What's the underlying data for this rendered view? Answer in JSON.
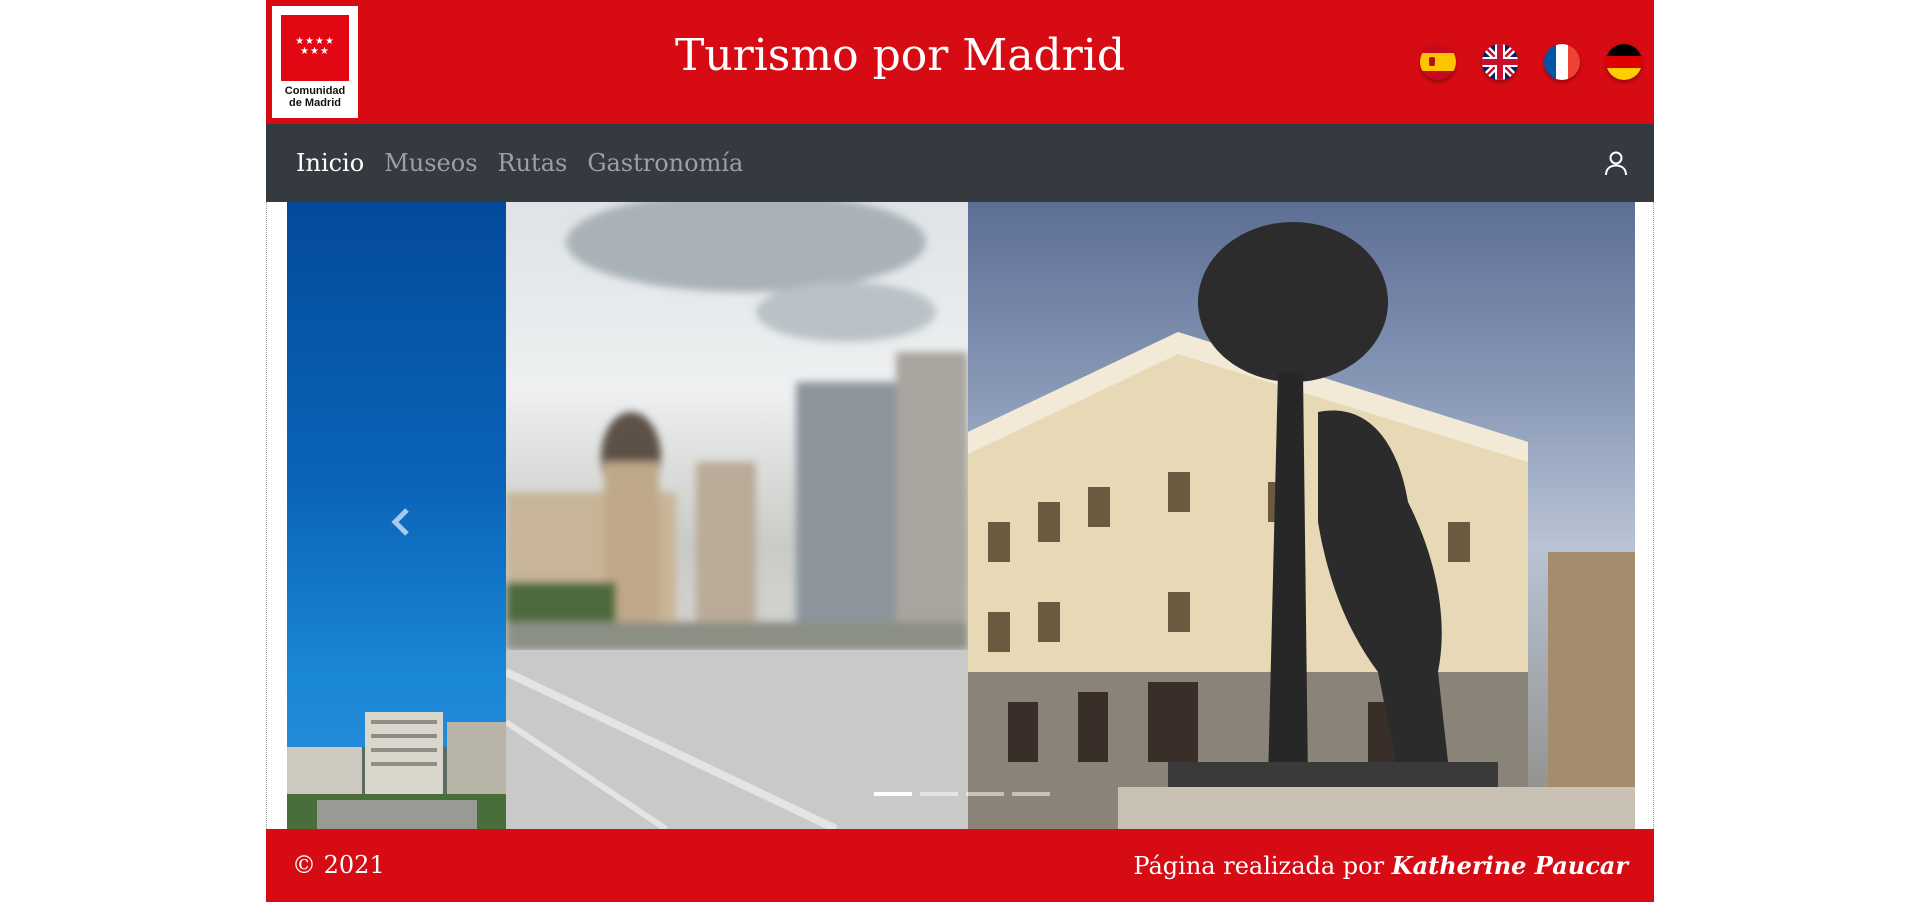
{
  "header": {
    "logo_text_line1": "Comunidad",
    "logo_text_line2": "de Madrid",
    "logo_stars": "★★★★\n★★★",
    "title": "Turismo por Madrid",
    "languages": [
      {
        "name": "Español",
        "icon": "spain-flag-icon"
      },
      {
        "name": "English",
        "icon": "uk-flag-icon"
      },
      {
        "name": "Français",
        "icon": "france-flag-icon"
      },
      {
        "name": "Deutsch",
        "icon": "germany-flag-icon"
      }
    ]
  },
  "nav": {
    "items": [
      {
        "label": "Inicio",
        "active": true
      },
      {
        "label": "Museos",
        "active": false
      },
      {
        "label": "Rutas",
        "active": false
      },
      {
        "label": "Gastronomía",
        "active": false
      }
    ],
    "user_icon": "user-icon"
  },
  "carousel": {
    "slides": [
      {
        "subject": "Madrid skyline under blue sky"
      },
      {
        "subject": "Gran Vía with Metropolis building (blurred)"
      },
      {
        "subject": "El Oso y el Madroño statue, Puerta del Sol"
      }
    ],
    "active_indicator": 0,
    "indicator_count": 4
  },
  "footer": {
    "copyright": "© 2021",
    "credit_prefix": "Página realizada por ",
    "author": "Katherine Paucar"
  },
  "colors": {
    "brand_red": "#d60b13",
    "nav_dark": "#343a40",
    "nav_inactive": "#9aa0a6"
  }
}
